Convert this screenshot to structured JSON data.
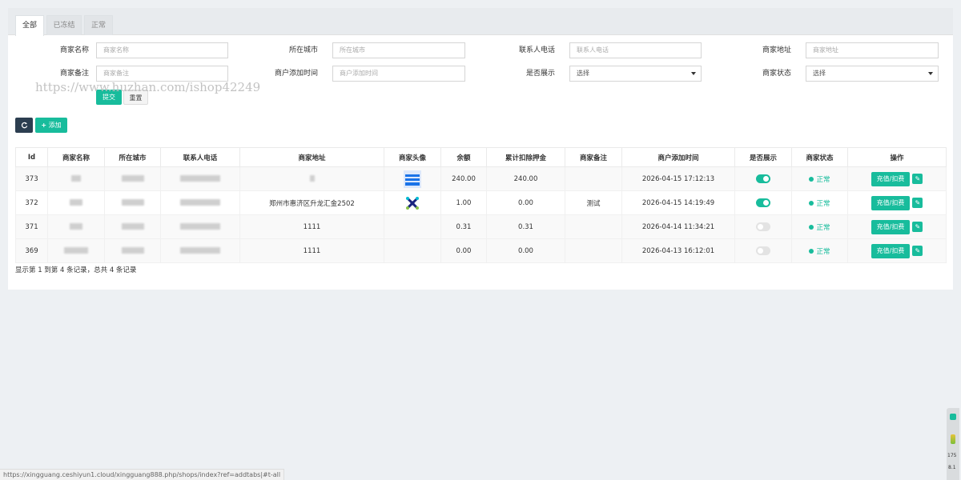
{
  "tabs": [
    {
      "label": "全部",
      "active": true
    },
    {
      "label": "已冻结",
      "active": false
    },
    {
      "label": "正常",
      "active": false
    }
  ],
  "filters": {
    "merchant_name": {
      "label": "商家名称",
      "placeholder": "商家名称"
    },
    "city": {
      "label": "所在城市",
      "placeholder": "所在城市"
    },
    "phone": {
      "label": "联系人电话",
      "placeholder": "联系人电话"
    },
    "address": {
      "label": "商家地址",
      "placeholder": "商家地址"
    },
    "remark": {
      "label": "商家备注",
      "placeholder": "商家备注"
    },
    "created": {
      "label": "商户添加时间",
      "placeholder": "商户添加时间"
    },
    "show": {
      "label": "是否展示",
      "value": "选择"
    },
    "status": {
      "label": "商家状态",
      "value": "选择"
    }
  },
  "actions": {
    "submit": "提交",
    "reset": "重置",
    "add": "添加"
  },
  "watermark": "https://www.huzhan.com/ishop42249",
  "table": {
    "headers": [
      "Id",
      "商家名称",
      "所在城市",
      "联系人电话",
      "商家地址",
      "商家头像",
      "余额",
      "累计扣除押金",
      "商家备注",
      "商户添加时间",
      "是否展示",
      "商家状态",
      "操作"
    ],
    "rows": [
      {
        "id": "373",
        "address": "",
        "balance": "240.00",
        "deducted": "240.00",
        "remark": "",
        "created": "2026-04-15 17:12:13",
        "show": true,
        "status": "正常"
      },
      {
        "id": "372",
        "address": "郑州市惠济区升龙汇金2502",
        "balance": "1.00",
        "deducted": "0.00",
        "remark": "测试",
        "created": "2026-04-15 14:19:49",
        "show": true,
        "status": "正常"
      },
      {
        "id": "371",
        "address": "1111",
        "balance": "0.31",
        "deducted": "0.31",
        "remark": "",
        "created": "2026-04-14 11:34:21",
        "show": false,
        "status": "正常"
      },
      {
        "id": "369",
        "address": "1111",
        "balance": "0.00",
        "deducted": "0.00",
        "remark": "",
        "created": "2026-04-13 16:12:01",
        "show": false,
        "status": "正常"
      }
    ],
    "op_label": "充值/扣费"
  },
  "summary": "显示第 1 到第 4 条记录，总共 4 条记录",
  "status_url": "https://xingguang.ceshiyun1.cloud/xingguang888.php/shops/index?ref=addtabs|#t-all",
  "side_widget": {
    "num1": "175",
    "num2": "8.1"
  },
  "colors": {
    "accent": "#18bc9c",
    "dark_button": "#2c3e50"
  }
}
